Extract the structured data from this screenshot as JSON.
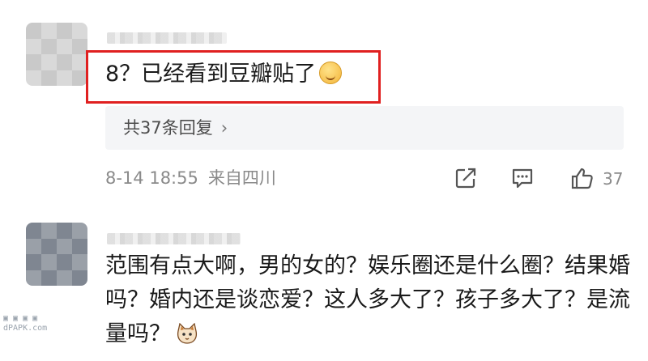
{
  "comment1": {
    "text": "8？已经看到豆瓣贴了",
    "emoji_icon": "drooling-face-emoji",
    "highlight_color": "#e02020",
    "replies_label": "共37条回复",
    "replies_chevron": "›",
    "date": "8-14 18:55",
    "source": "来自四川",
    "actions": {
      "share_icon": "share-icon",
      "comment_icon": "comment-icon",
      "like_icon": "thumbs-up-icon",
      "like_count": "37"
    }
  },
  "comment2": {
    "text": "范围有点大啊，男的女的？娱乐圈还是什么圈？结果婚吗？婚内还是谈恋爱？这人多大了？孩子多大了？是流量吗？",
    "emoji_icon": "cat-face-emoji"
  },
  "watermark": {
    "line1": "▣ ▣ ▣ ▣",
    "line2": "dPAPK.com"
  }
}
